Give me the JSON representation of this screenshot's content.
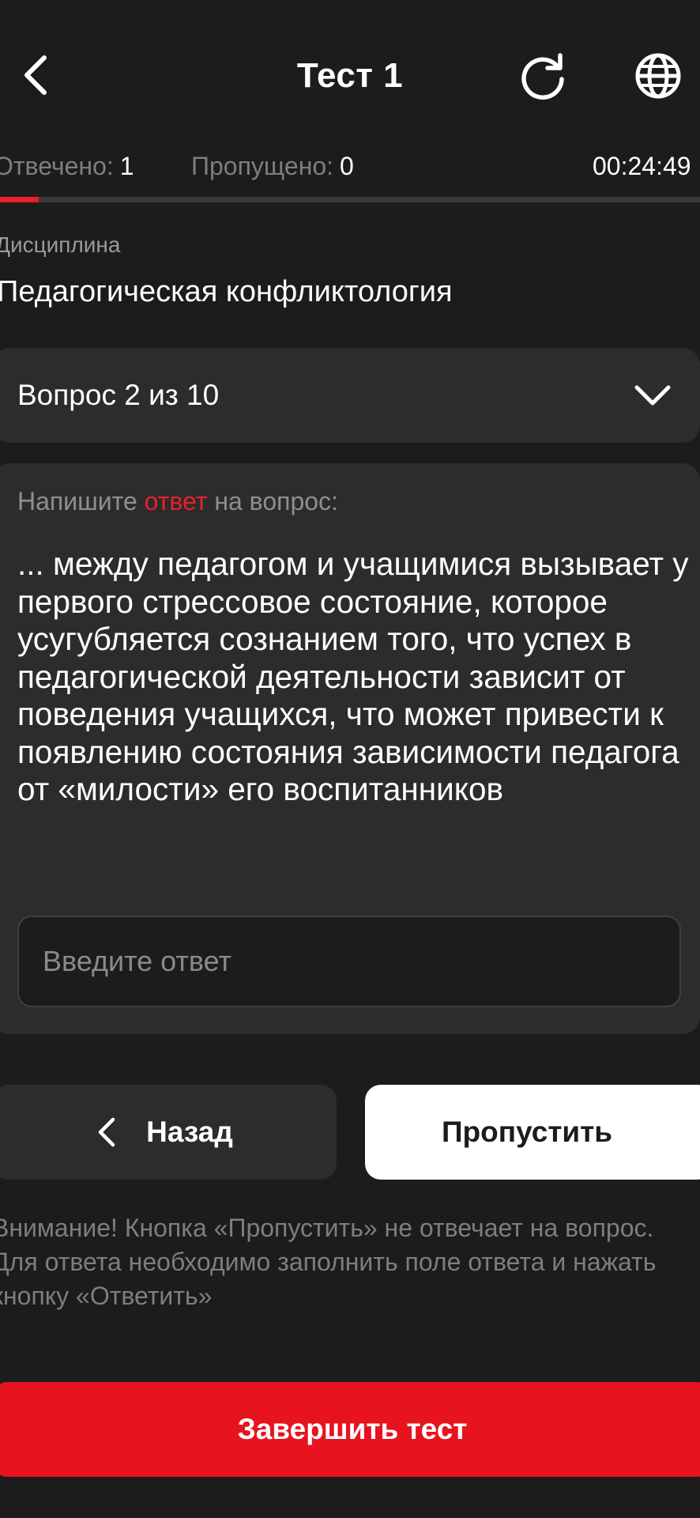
{
  "header": {
    "title": "Тест 1",
    "back_icon": "chevron-left-icon",
    "refresh_icon": "refresh-icon",
    "language_icon": "globe-icon"
  },
  "stats": {
    "answered_label": "Отвечено:",
    "answered_value": "1",
    "skipped_label": "Пропущено:",
    "skipped_value": "0",
    "timer": "00:24:49"
  },
  "progress": {
    "fraction": 0.055,
    "color": "#e7202b"
  },
  "discipline": {
    "label": "Дисциплина",
    "value": "Педагогическая конфликтология"
  },
  "question_select": {
    "label": "Вопрос 2 из 10"
  },
  "question": {
    "instruction_prefix": "Напишите ",
    "instruction_accent": "ответ",
    "instruction_suffix": " на вопрос:",
    "text": "... между педагогом и учащимися вызывает у первого стрессовое состояние, которое усугубляется сознанием того, что успех в педагогической деятельности зависит от поведения учащихся, что может привести к появлению состояния зависимости педагога от «милости» его воспитанников",
    "answer_value": "",
    "answer_placeholder": "Введите ответ"
  },
  "buttons": {
    "back_label": "Назад",
    "skip_label": "Пропустить",
    "finish_label": "Завершить тест"
  },
  "warning": "Внимание! Кнопка «Пропустить» не отвечает на вопрос. Для ответа необходимо заполнить поле ответа и нажать кнопку «Ответить»",
  "colors": {
    "background": "#1c1c1c",
    "card": "#2c2c2c",
    "accent": "#e7202b"
  }
}
